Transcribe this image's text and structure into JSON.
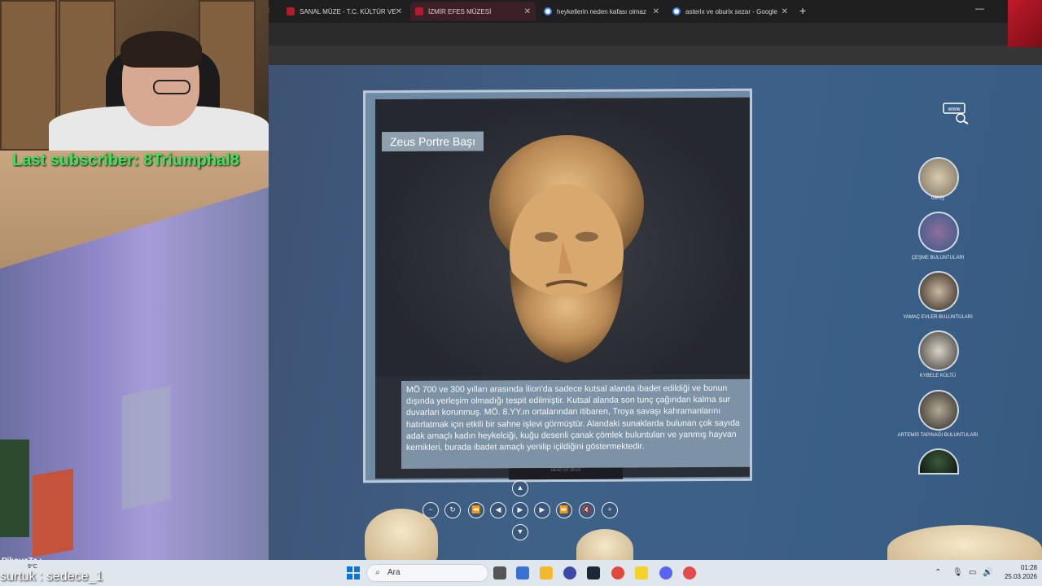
{
  "browser": {
    "tabs": [
      {
        "label": "SANAL MÜZE - T.C. KÜLTÜR VE",
        "active": false,
        "favicon": "#b31b2b"
      },
      {
        "label": "İZMİR EFES MÜZESİ",
        "active": true,
        "favicon": "#b31b2b"
      },
      {
        "label": "heykellerin neden kafası olmaz",
        "active": false,
        "favicon": "#4285f4"
      },
      {
        "label": "asterix ve oburix sezar - Google",
        "active": false,
        "favicon": "#4285f4"
      }
    ],
    "new_tab": "+",
    "scroll_left": "‹"
  },
  "stream": {
    "last_subscriber": "Last subscriber: 8Triumphal8",
    "chat_user": "PikouzZz :",
    "chat_line": "surtuk : sedece_1"
  },
  "artifact": {
    "title": "Zeus Portre Başı",
    "description": "MÖ 700 ve 300 yılları arasında İlion'da sadece kutsal alanda ibadet edildiği ve bunun dışında yerleşim olmadığı tespit edilmiştir. Kutsal alanda son tunç çağından kalma sur duvarları korunmuş. MÖ. 8.YY.ın ortalarından itibaren, Troya savaşı kahramanlarını hatırlatmak için etkili bir sahne işlevi görmüştür. Alandaki sunaklarda bulunan çok sayıda adak amaçlı kadın heykelciği, kuğu desenli çanak çömlek buluntuları ve yanmış hayvan kemikleri, burada ibadet amaçlı yenilip içildiğini göstermektedir.",
    "plaque": "HEAD OF ZEUS"
  },
  "controls": {
    "up": "▲",
    "down": "▼",
    "zoom_out": "−",
    "reset": "↻",
    "rewind": "⏪",
    "prev": "◀",
    "play": "▶",
    "next": "▶",
    "forward": "⏩",
    "mute": "🔇",
    "zoom_in": "+"
  },
  "rooms": [
    {
      "label": "GİRİŞ",
      "color": "#a89f8e"
    },
    {
      "label": "ÇEŞME BULUNTULARI",
      "color": "#4d6a95"
    },
    {
      "label": "YAMAÇ EVLER BULUNTULARI",
      "color": "#3a302b"
    },
    {
      "label": "KYBELE KÜLTÜ",
      "color": "#4a4844"
    },
    {
      "label": "ARTEMİS TAPINAĞI BULUNTULARI",
      "color": "#3b3a35"
    },
    {
      "label": "",
      "color": "#142018"
    }
  ],
  "www_icon_label": "www",
  "taskbar": {
    "search_placeholder": "Ara",
    "time": "01:28",
    "date": "25.03.2026",
    "weather_temp": "9°C"
  }
}
